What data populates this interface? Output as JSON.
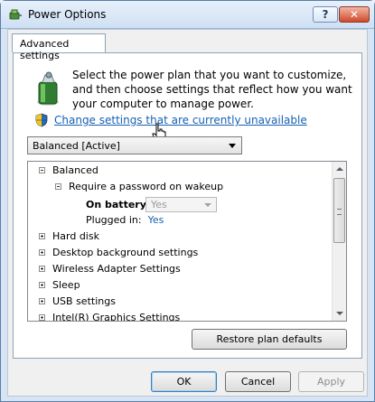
{
  "window": {
    "title": "Power Options"
  },
  "titlebar": {
    "help_label": "?",
    "close_label": "✕"
  },
  "tab": {
    "label": "Advanced settings"
  },
  "intro": {
    "text": "Select the power plan that you want to customize, and then choose settings that reflect how you want your computer to manage power."
  },
  "link": {
    "text": "Change settings that are currently unavailable"
  },
  "plan_select": {
    "value": "Balanced [Active]"
  },
  "tree": {
    "items": [
      {
        "label": "Balanced",
        "expanded": true
      },
      {
        "label": "Require a password on wakeup",
        "expanded": true
      },
      {
        "label": "Hard disk",
        "expanded": false
      },
      {
        "label": "Desktop background settings",
        "expanded": false
      },
      {
        "label": "Wireless Adapter Settings",
        "expanded": false
      },
      {
        "label": "Sleep",
        "expanded": false
      },
      {
        "label": "USB settings",
        "expanded": false
      },
      {
        "label": "Intel(R) Graphics Settings",
        "expanded": false
      }
    ],
    "on_battery": {
      "label": "On battery:",
      "value": "Yes"
    },
    "plugged_in": {
      "label": "Plugged in:",
      "value": "Yes"
    }
  },
  "buttons": {
    "restore": "Restore plan defaults",
    "ok": "OK",
    "cancel": "Cancel",
    "apply": "Apply"
  },
  "colors": {
    "link": "#1561b3",
    "panel_border": "#8da2b5",
    "title_gradient": "#cfe0f3"
  },
  "icons": [
    "power-options-icon",
    "battery-plan-icon",
    "uac-shield-icon",
    "hand-cursor-icon"
  ]
}
